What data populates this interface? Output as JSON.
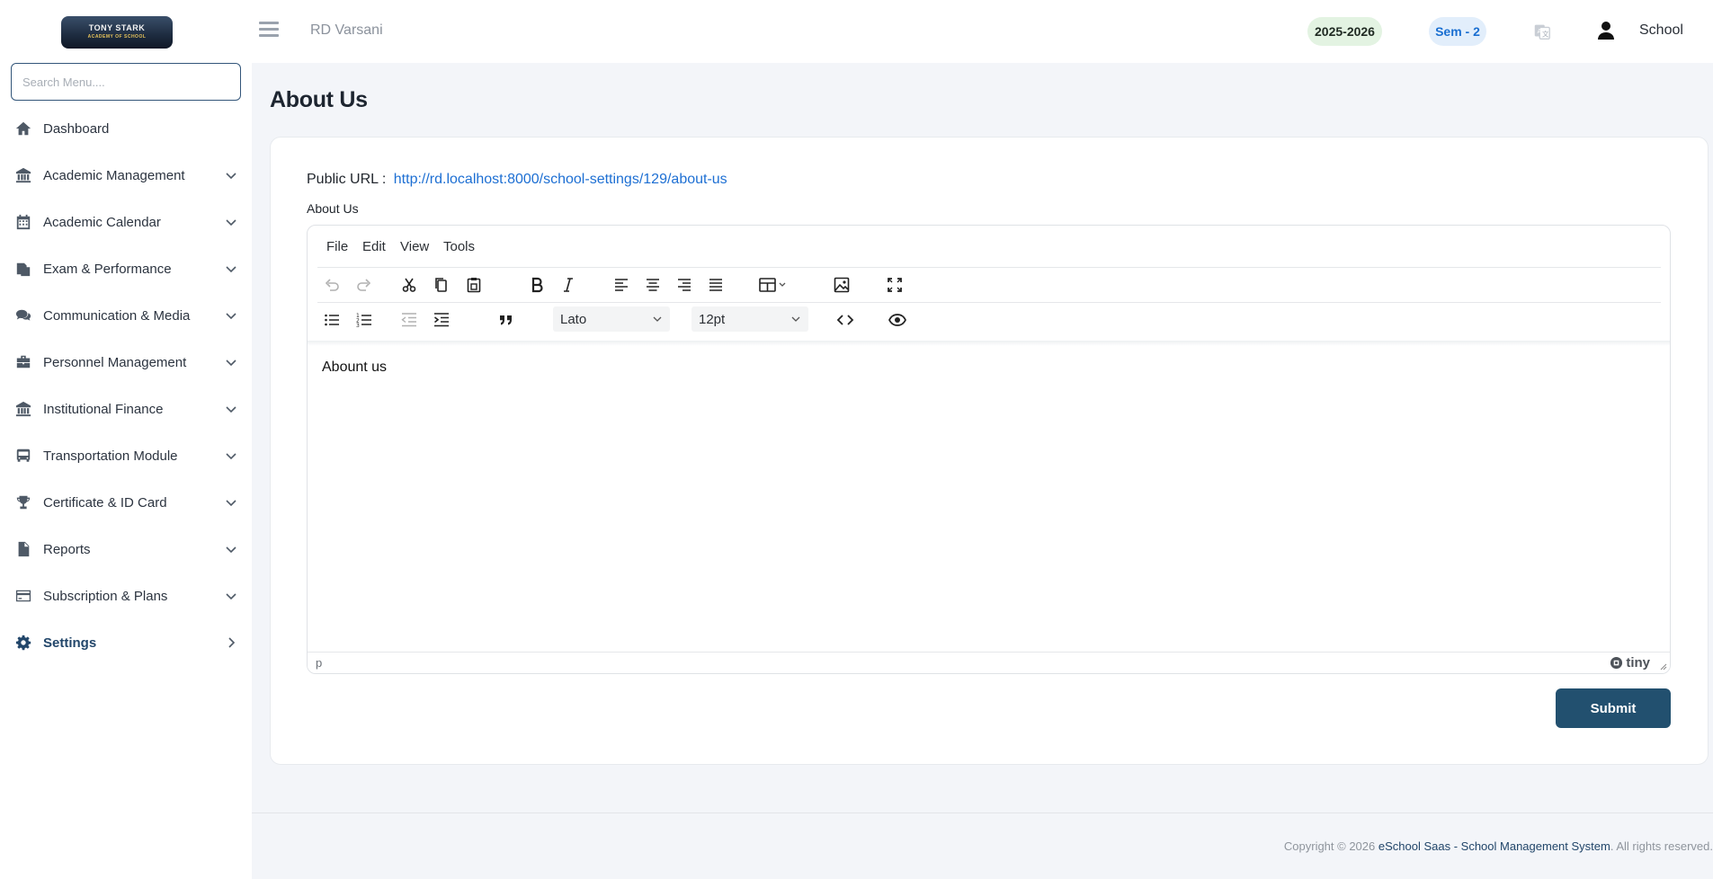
{
  "header": {
    "logo_text": "TONY STARK",
    "logo_subtext": "ACADEMY OF SCHOOL",
    "user_name": "RD Varsani",
    "session_year": "2025-2026",
    "semester": "Sem - 2",
    "profile_label": "School"
  },
  "sidebar": {
    "search_placeholder": "Search Menu....",
    "items": [
      {
        "label": "Dashboard",
        "icon": "home-icon"
      },
      {
        "label": "Academic Management",
        "icon": "institution-icon"
      },
      {
        "label": "Academic Calendar",
        "icon": "calendar-icon"
      },
      {
        "label": "Exam & Performance",
        "icon": "copy-docs-icon"
      },
      {
        "label": "Communication & Media",
        "icon": "chat-icon"
      },
      {
        "label": "Personnel Management",
        "icon": "briefcase-icon"
      },
      {
        "label": "Institutional Finance",
        "icon": "institution-icon"
      },
      {
        "label": "Transportation Module",
        "icon": "bus-icon"
      },
      {
        "label": "Certificate & ID Card",
        "icon": "trophy-icon"
      },
      {
        "label": "Reports",
        "icon": "file-icon"
      },
      {
        "label": "Subscription & Plans",
        "icon": "credit-card-icon"
      },
      {
        "label": "Settings",
        "icon": "gear-icon"
      }
    ]
  },
  "main": {
    "page_title": "About Us",
    "public_url_label": "Public URL :",
    "public_url": "http://rd.localhost:8000/school-settings/129/about-us",
    "field_label": "About Us",
    "submit_label": "Submit"
  },
  "editor": {
    "menu": [
      "File",
      "Edit",
      "View",
      "Tools"
    ],
    "font_family": "Lato",
    "font_size": "12pt",
    "content": "Abount us",
    "status_path": "p",
    "brand": "tiny"
  },
  "footer": {
    "prefix": "Copyright © 2026 ",
    "link": "eSchool Saas - School Management System",
    "suffix": ". All rights reserved."
  },
  "colors": {
    "primary": "#22506f",
    "link": "#1d6fd3",
    "year_pill_bg": "#e3f3e2",
    "sem_pill_bg": "#e2eefb"
  }
}
